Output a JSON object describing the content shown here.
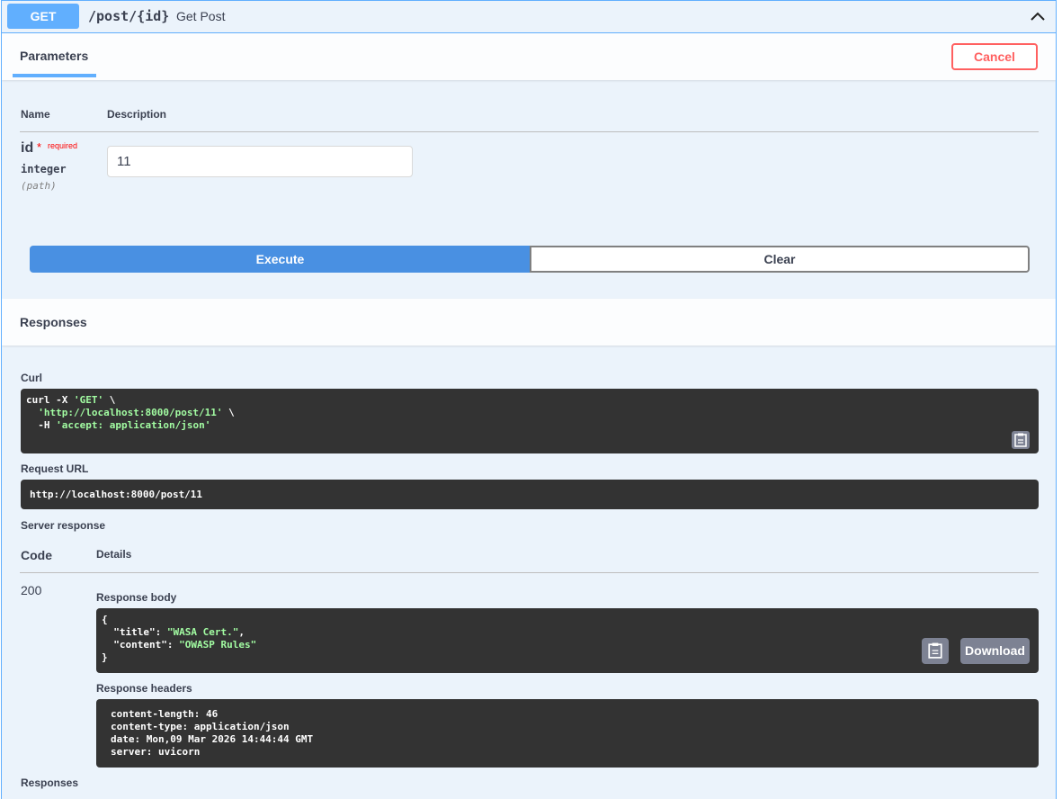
{
  "summary": {
    "method": "GET",
    "path": "/post/{id}",
    "description": "Get Post"
  },
  "tabs": {
    "parameters": "Parameters",
    "cancel": "Cancel"
  },
  "params_table": {
    "headers": {
      "name": "Name",
      "description": "Description"
    },
    "param": {
      "name": "id",
      "star": "*",
      "required": "required",
      "type": "integer",
      "in": "(path)",
      "value": "11"
    }
  },
  "actions": {
    "execute": "Execute",
    "clear": "Clear"
  },
  "responses": {
    "title": "Responses",
    "curl_label": "Curl",
    "curl": {
      "line1_pre": "curl -X ",
      "line1_str": "'GET'",
      "line1_post": " \\",
      "line2_str": "'http://localhost:8000/post/11'",
      "line2_post": " \\",
      "line3_pre": "-H ",
      "line3_str": "'accept: application/json'"
    },
    "request_url_label": "Request URL",
    "request_url": "http://localhost:8000/post/11",
    "server_response_label": "Server response",
    "code_header": "Code",
    "details_header": "Details",
    "status_code": "200",
    "body_label": "Response body",
    "body": {
      "open": "{",
      "k1": "\"title\"",
      "v1": "\"WASA Cert.\"",
      "k2": "\"content\"",
      "v2": "\"OWASP Rules\"",
      "close": "}"
    },
    "download": "Download",
    "headers_label": "Response headers",
    "headers": [
      "content-length: 46",
      "content-type: application/json",
      "date: Mon,09 Mar 2026 14:44:44 GMT",
      "server: uvicorn"
    ],
    "footer": "Responses"
  },
  "colors": {
    "get": "#61affe",
    "execute": "#4990e2",
    "cancel": "#ff6060",
    "code_bg": "#333333",
    "string": "#a2fca2"
  },
  "icons": {
    "collapse": "chevron-up-icon",
    "copy": "clipboard-icon"
  }
}
